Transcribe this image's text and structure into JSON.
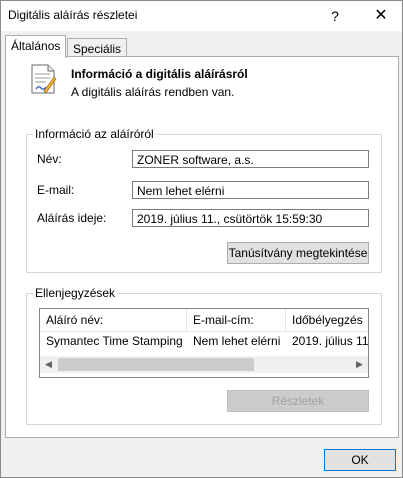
{
  "window": {
    "title": "Digitális aláírás részletei",
    "help_glyph": "?",
    "close_glyph": "✕"
  },
  "tabs": [
    {
      "label": "Általános"
    },
    {
      "label": "Speciális"
    }
  ],
  "info": {
    "title": "Információ a digitális aláírásról",
    "subtitle": "A digitális aláírás rendben van."
  },
  "signer": {
    "group_label": "Információ az aláíróról",
    "name_label": "Név:",
    "name_value": "ZONER software, a.s.",
    "email_label": "E-mail:",
    "email_value": "Nem lehet elérni",
    "time_label": "Aláírás ideje:",
    "time_value": "2019. július 11., csütörtök 15:59:30",
    "view_cert_button": "Tanúsítvány megtekintése"
  },
  "countersignatures": {
    "group_label": "Ellenjegyzések",
    "columns": [
      "Aláíró név:",
      "E-mail-cím:",
      "Időbélyegzés"
    ],
    "rows": [
      [
        "Symantec Time Stamping ...",
        "Nem lehet elérni",
        "2019. július 11..."
      ]
    ],
    "details_button": "Részletek"
  },
  "footer": {
    "ok_button": "OK"
  },
  "icons": {
    "document": "document-signature-icon",
    "scroll_left": "◀",
    "scroll_right": "▶"
  }
}
